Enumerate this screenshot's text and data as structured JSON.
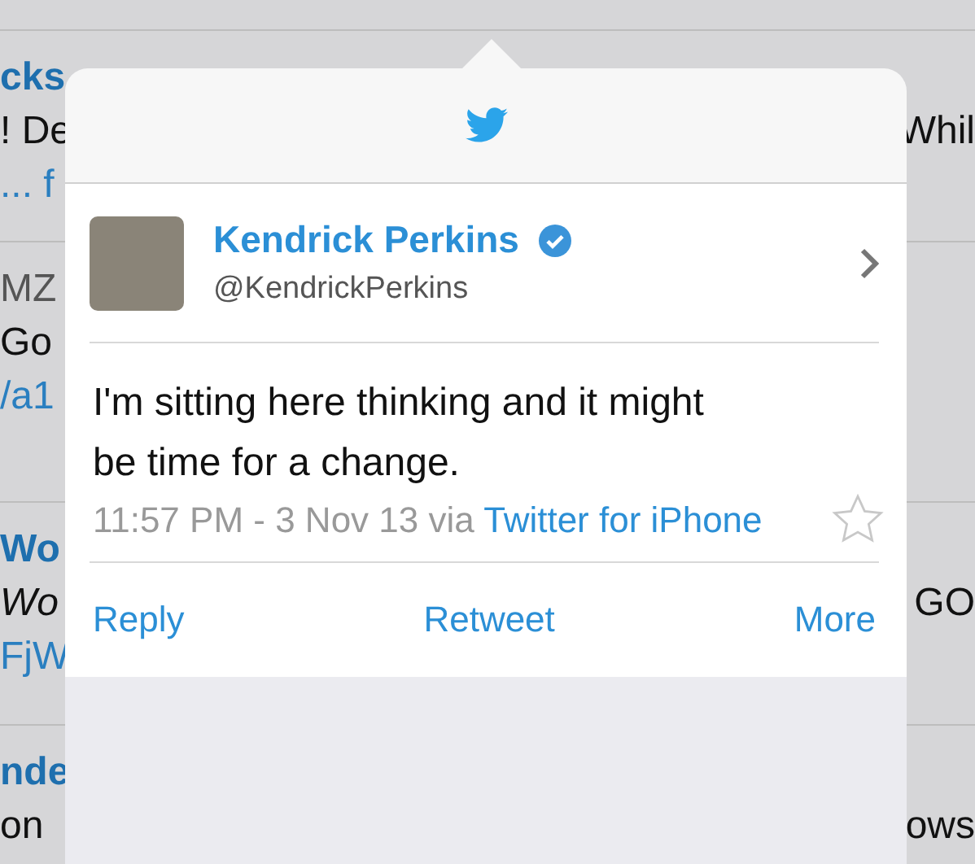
{
  "timeline": {
    "rows": [
      {
        "lines": [
          {
            "text": "cks",
            "kind": "name"
          },
          {
            "text": "! De",
            "kind": "text",
            "right": "Whil"
          },
          {
            "text": "... f",
            "kind": "link"
          }
        ]
      },
      {
        "lines": [
          {
            "text": "MZ",
            "kind": "handle"
          },
          {
            "text": "Go",
            "kind": "text"
          },
          {
            "text": "/a1",
            "kind": "link"
          }
        ]
      },
      {
        "lines": [
          {
            "text": "Wo",
            "kind": "name"
          },
          {
            "text": "Wo",
            "kind": "italic",
            "right": "GO"
          },
          {
            "text": "FjW",
            "kind": "link"
          }
        ]
      },
      {
        "lines": [
          {
            "text": "nde",
            "kind": "name"
          },
          {
            "text": "on",
            "kind": "text",
            "right": "ows"
          }
        ]
      }
    ]
  },
  "popover": {
    "user": {
      "name": "Kendrick Perkins",
      "verified": true,
      "handle": "@KendrickPerkins"
    },
    "tweet": {
      "text": "I'm sitting here thinking and it might be time for a change.",
      "timestamp": "11:57 PM - 3 Nov 13 via",
      "source": "Twitter for iPhone",
      "favorited": false
    },
    "actions": [
      "Reply",
      "Retweet",
      "More"
    ]
  }
}
